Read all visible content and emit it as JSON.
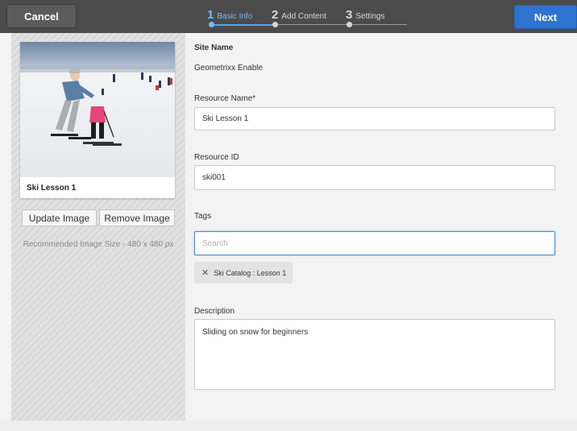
{
  "topbar": {
    "cancel_label": "Cancel",
    "next_label": "Next",
    "steps": [
      {
        "num": "1",
        "label": "Basic Info",
        "active": true
      },
      {
        "num": "2",
        "label": "Add Content",
        "active": false
      },
      {
        "num": "3",
        "label": "Settings",
        "active": false
      }
    ]
  },
  "preview": {
    "caption": "Ski Lesson 1",
    "update_label": "Update Image",
    "remove_label": "Remove Image",
    "recommended": "Recommended Image Size - 480 x 480 px"
  },
  "form": {
    "site_name_label": "Site Name",
    "site_name_value": "Geometrixx Enable",
    "resource_name_label": "Resource Name*",
    "resource_name_value": "Ski Lesson 1",
    "resource_id_label": "Resource ID",
    "resource_id_value": "ski001",
    "tags_label": "Tags",
    "tags_placeholder": "Search",
    "tags": [
      "Ski Catalog : Lesson 1"
    ],
    "description_label": "Description",
    "description_value": "Sliding on snow for beginners"
  },
  "colors": {
    "topbar": "#4b4b4b",
    "accent": "#2f73d1",
    "step_active": "#79b7ff"
  }
}
